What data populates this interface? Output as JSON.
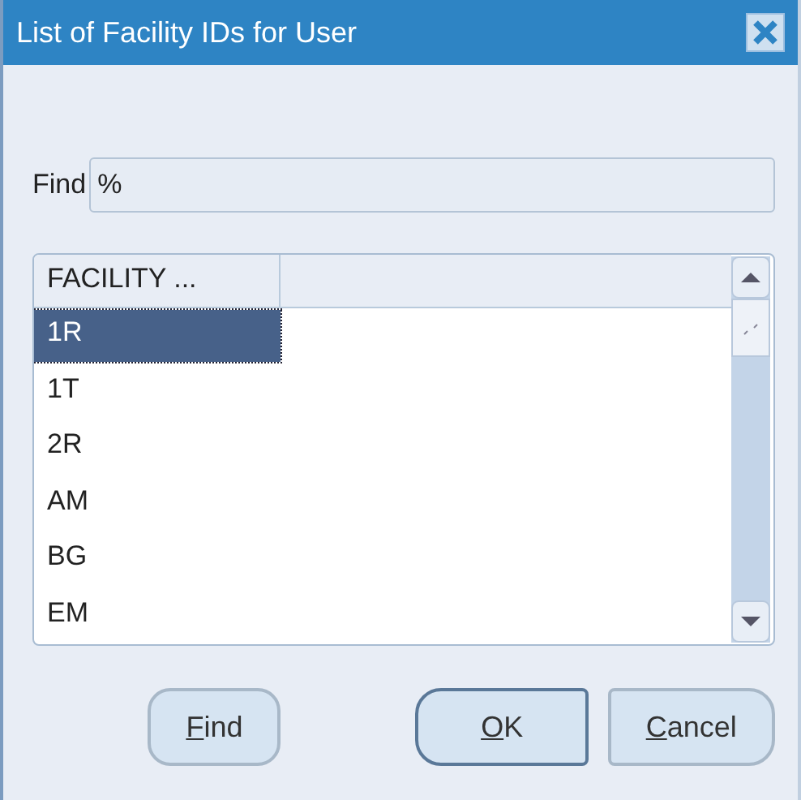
{
  "window": {
    "title": "List of Facility IDs for User"
  },
  "find": {
    "label": "Find",
    "value": "%"
  },
  "table": {
    "columns": [
      "FACILITY ..."
    ],
    "rows": [
      {
        "cell": "1R",
        "selected": true
      },
      {
        "cell": "1T",
        "selected": false
      },
      {
        "cell": "2R",
        "selected": false
      },
      {
        "cell": "AM",
        "selected": false
      },
      {
        "cell": "BG",
        "selected": false
      },
      {
        "cell": "EM",
        "selected": false
      }
    ]
  },
  "buttons": [
    {
      "key": "F",
      "after": "ind",
      "default": false
    },
    {
      "key": "O",
      "after": "K",
      "default": true
    },
    {
      "key": "C",
      "after": "ancel",
      "default": false
    }
  ]
}
